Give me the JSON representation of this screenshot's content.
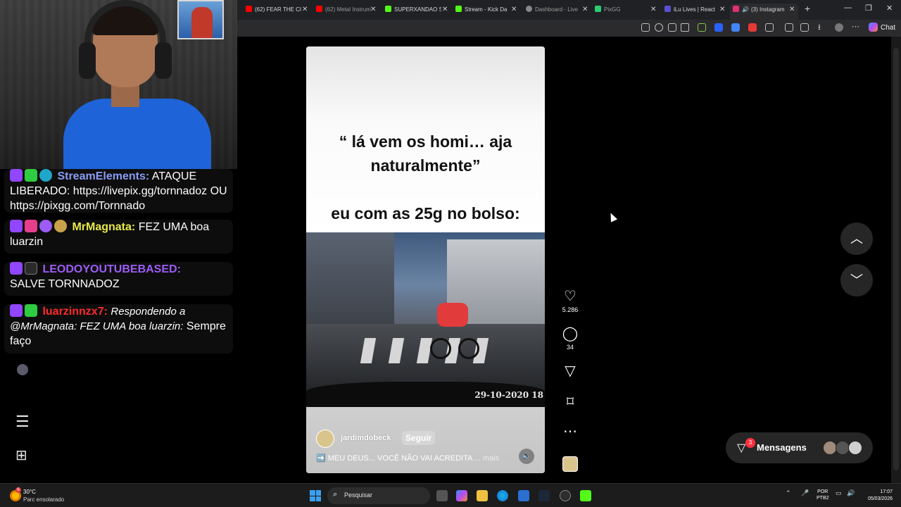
{
  "browser": {
    "tabs": [
      {
        "label": "(62) FEAR THE CI",
        "color": "#ff0000"
      },
      {
        "label": "(62) Metal Instrum",
        "color": "#ff0000"
      },
      {
        "label": "SUPERXANDAO S",
        "color": "#53fc18"
      },
      {
        "label": "Stream - Kick Da",
        "color": "#53fc18"
      },
      {
        "label": "Dashboard - Live",
        "color": "#888888"
      },
      {
        "label": "PixGG",
        "color": "#2ecc71"
      },
      {
        "label": "iLu Lives | React",
        "color": "#5a4fcf"
      },
      {
        "label": "(3) Instagram",
        "color": "#e1306c"
      }
    ],
    "chat_button": "Chat"
  },
  "chat": {
    "messages": [
      {
        "user": "StreamElements:",
        "user_color": "#8a9cf5",
        "text": "ATAQUE LIBERADO: https://livepix.gg/tornnadoz OU https://pixgg.com/Tornnado"
      },
      {
        "user": "MrMagnata:",
        "user_color": "#e8e84a",
        "text": "FEZ UMA boa luarzin"
      },
      {
        "user": "LEODOYOUTUBEBASED:",
        "user_color": "#9d5cf5",
        "text": "SALVE TORNNADOZ"
      },
      {
        "user": "luarzinnzx7:",
        "user_color": "#ff2a2a",
        "reply": "Respondendo a @MrMagnata: FEZ UMA boa luarzin:",
        "text": "Sempre faço"
      }
    ]
  },
  "reel": {
    "caption_line1": "“ lá vem os homi… aja",
    "caption_line2": "naturalmente”",
    "caption_line3": "eu com as 25g no bolso:",
    "timestamp": "29-10-2020 18",
    "author": "jardimdobeck",
    "follow_label": "Seguir",
    "description": "➡️ MEU DEUS... VOCÊ NÃO VAI ACREDITA",
    "more_label": "... mais"
  },
  "actions": {
    "likes": "5.286",
    "comments": "34"
  },
  "messages": {
    "label": "Mensagens",
    "badge": "3"
  },
  "taskbar": {
    "temperature": "30°C",
    "weather": "Parc ensolarado",
    "search_placeholder": "Pesquisar",
    "lang_top": "POR",
    "lang_bottom": "PTB2",
    "time": "17:07",
    "date": "05/03/2026"
  }
}
